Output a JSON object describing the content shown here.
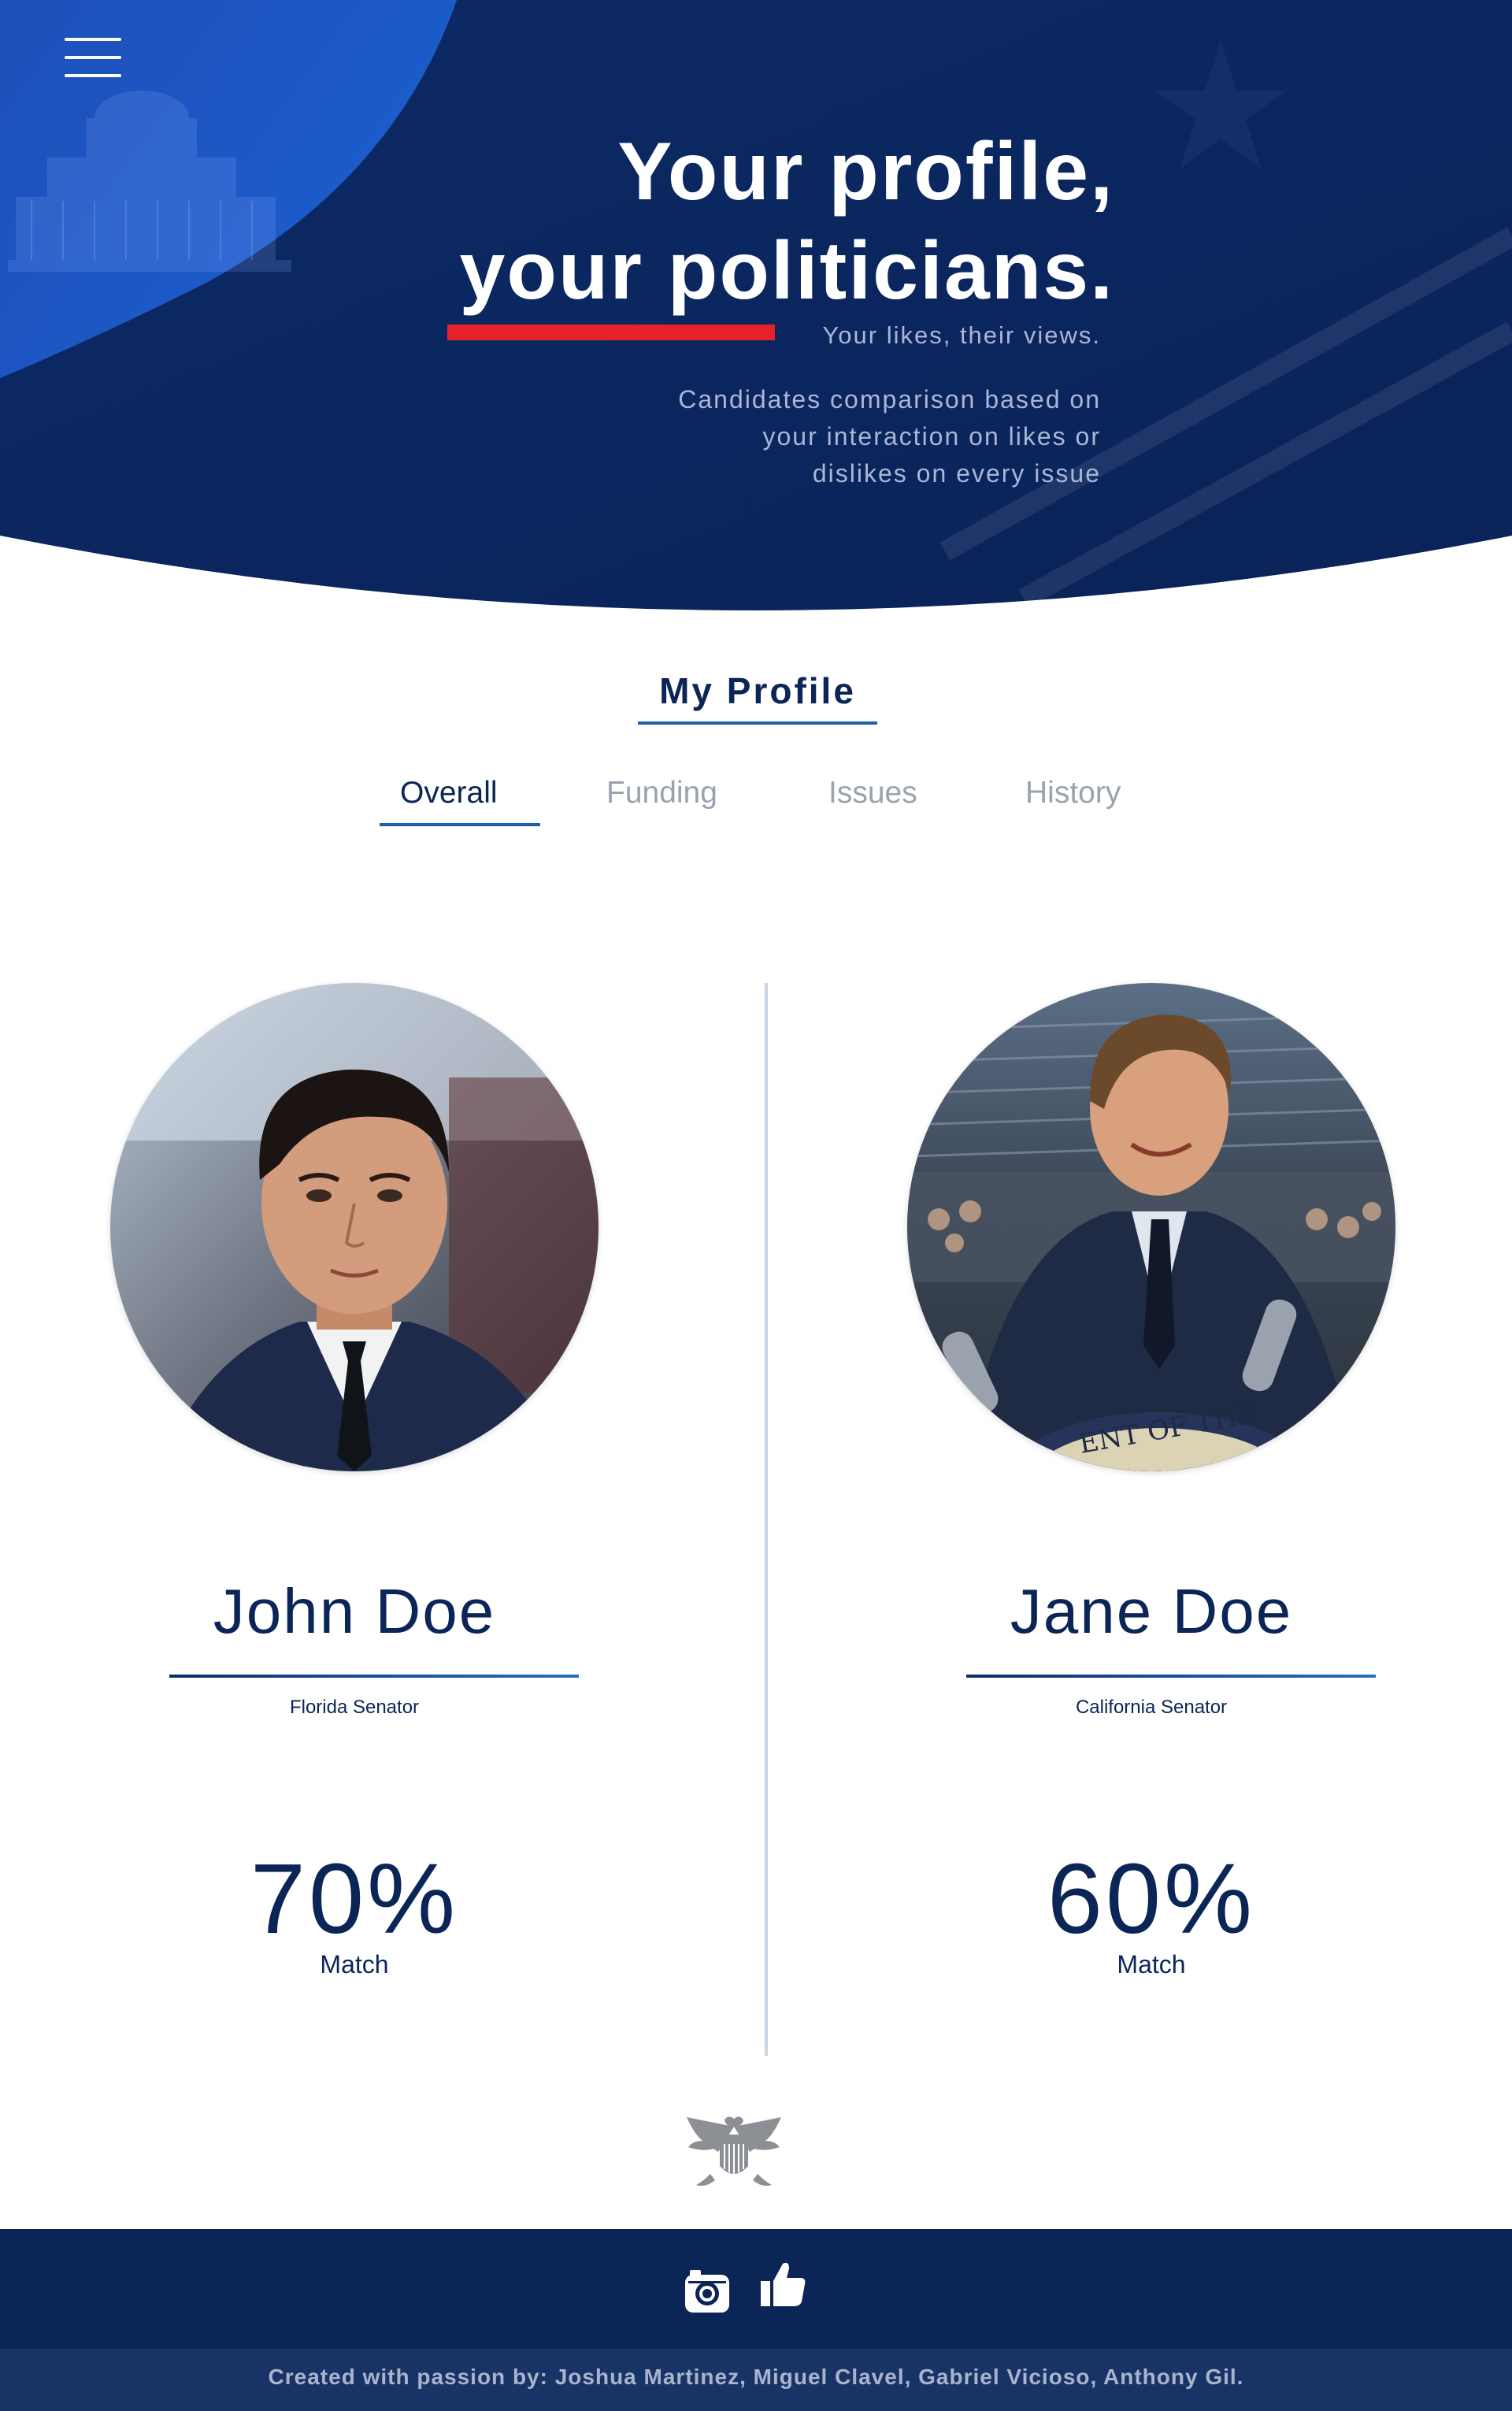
{
  "hero": {
    "title_line1": "Your profile,",
    "title_line2": "your politicians.",
    "tagline": "Your likes, their views.",
    "description_lines": [
      "Candidates comparison based on",
      "your interaction on likes or",
      "dislikes on every issue"
    ]
  },
  "profile": {
    "section_title": "My Profile",
    "tabs": [
      {
        "label": "Overall",
        "active": true
      },
      {
        "label": "Funding",
        "active": false
      },
      {
        "label": "Issues",
        "active": false
      },
      {
        "label": "History",
        "active": false
      }
    ]
  },
  "candidates": [
    {
      "name": "John Doe",
      "title": "Florida Senator",
      "match_percent": "70%",
      "match_label": "Match"
    },
    {
      "name": "Jane Doe",
      "title": "California Senator",
      "match_percent": "60%",
      "match_label": "Match"
    }
  ],
  "footer": {
    "icons": [
      "camera-icon",
      "thumbs-up-icon"
    ],
    "credits": "Created with passion by: Joshua Martinez, Miguel Clavel, Gabriel Vicioso, Anthony Gil."
  },
  "colors": {
    "navy": "#0b2557",
    "accent_blue": "#1d5fa8",
    "red": "#e8202a",
    "muted_text": "#aab6d6",
    "inactive_tab": "#9aa3ad"
  }
}
